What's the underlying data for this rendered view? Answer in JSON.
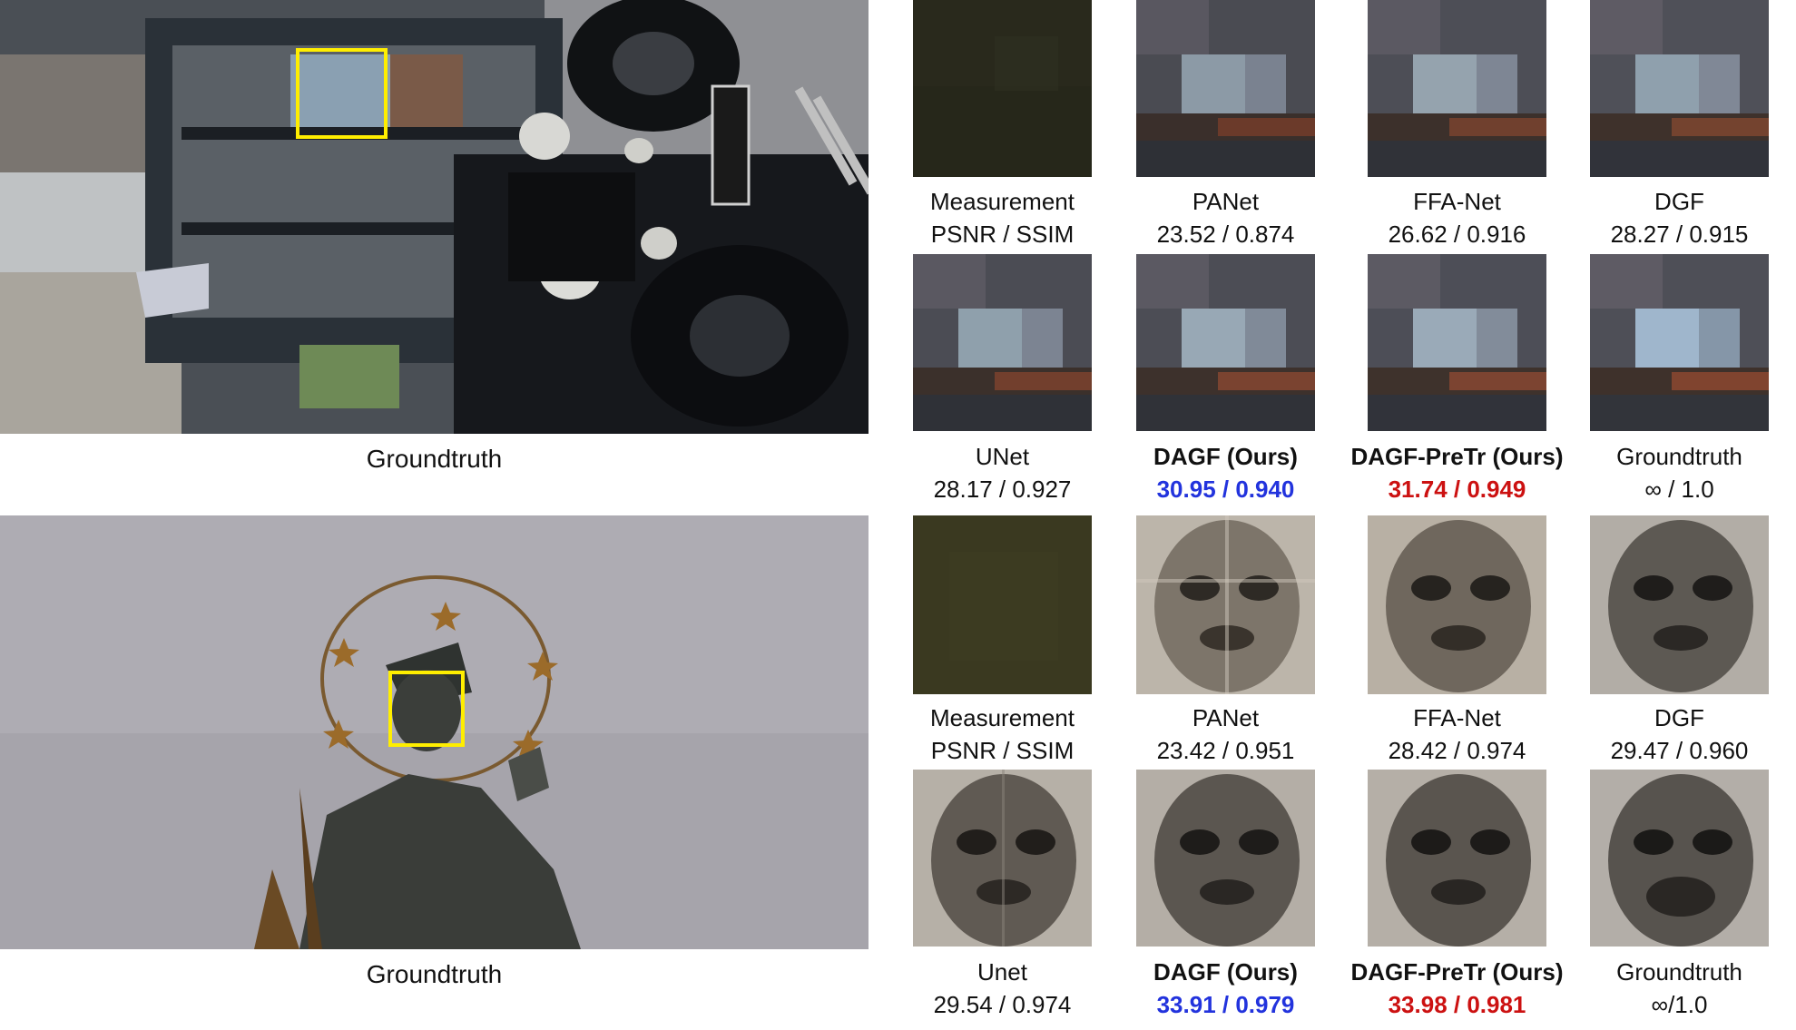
{
  "rows": [
    {
      "main_caption": "Groundtruth",
      "cells": [
        {
          "name": "Measurement",
          "metrics": "PSNR / SSIM",
          "style": "normal"
        },
        {
          "name": "PANet",
          "metrics": "23.52 / 0.874",
          "style": "normal"
        },
        {
          "name": "FFA-Net",
          "metrics": "26.62 / 0.916",
          "style": "normal"
        },
        {
          "name": "DGF",
          "metrics": "28.27 / 0.915",
          "style": "normal"
        },
        {
          "name": "UNet",
          "metrics": "28.17 / 0.927",
          "style": "normal"
        },
        {
          "name": "DAGF (Ours)",
          "metrics": "30.95 / 0.940",
          "style": "blue"
        },
        {
          "name": "DAGF-PreTr (Ours)",
          "metrics": "31.74 / 0.949",
          "style": "red"
        },
        {
          "name": "Groundtruth",
          "metrics": "∞ / 1.0",
          "style": "normal"
        }
      ]
    },
    {
      "main_caption": "Groundtruth",
      "cells": [
        {
          "name": "Measurement",
          "metrics": "PSNR / SSIM",
          "style": "normal"
        },
        {
          "name": "PANet",
          "metrics": "23.42 / 0.951",
          "style": "normal"
        },
        {
          "name": "FFA-Net",
          "metrics": "28.42 / 0.974",
          "style": "normal"
        },
        {
          "name": "DGF",
          "metrics": "29.47 / 0.960",
          "style": "normal"
        },
        {
          "name": "Unet",
          "metrics": "29.54 / 0.974",
          "style": "normal"
        },
        {
          "name": "DAGF (Ours)",
          "metrics": "33.91 / 0.979",
          "style": "blue"
        },
        {
          "name": "DAGF-PreTr (Ours)",
          "metrics": "33.98 / 0.981",
          "style": "red"
        },
        {
          "name": "Groundtruth",
          "metrics": "∞/1.0",
          "style": "normal"
        }
      ]
    }
  ],
  "colors": {
    "highlight_box": "#ffee00",
    "best_metric": "#cc1111",
    "second_metric": "#2233dd"
  }
}
